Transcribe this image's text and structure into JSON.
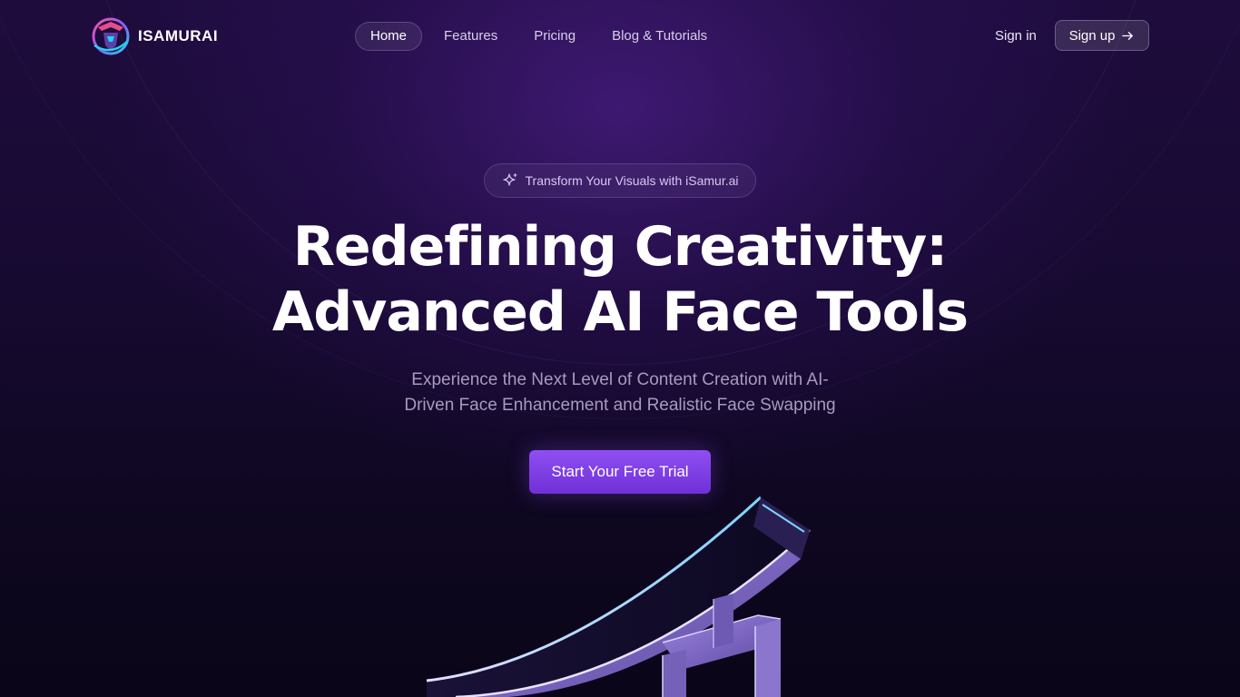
{
  "brand": {
    "name": "ISAMURAI"
  },
  "nav": {
    "items": [
      {
        "label": "Home",
        "active": true
      },
      {
        "label": "Features",
        "active": false
      },
      {
        "label": "Pricing",
        "active": false
      },
      {
        "label": "Blog & Tutorials",
        "active": false
      }
    ]
  },
  "auth": {
    "signin_label": "Sign in",
    "signup_label": "Sign up",
    "signup_icon": "arrow-right-icon"
  },
  "hero": {
    "badge_icon": "sparkle-icon",
    "badge_text": "Transform Your Visuals with iSamur.ai",
    "title_lines": [
      "Redefining Creativity:",
      "Advanced AI Face Tools"
    ],
    "subtitle_lines": [
      "Experience the Next Level of Content Creation with AI-",
      "Driven Face Enhancement and Realistic Face Swapping"
    ],
    "cta_label": "Start Your Free Trial"
  },
  "colors": {
    "background": "#170a31",
    "accent": "#7c3aed",
    "cta_gradient_top": "#8e4ef2",
    "cta_gradient_bottom": "#6f31d6",
    "subtitle": "#a89bbd",
    "badge_text": "#d8c8f4"
  }
}
